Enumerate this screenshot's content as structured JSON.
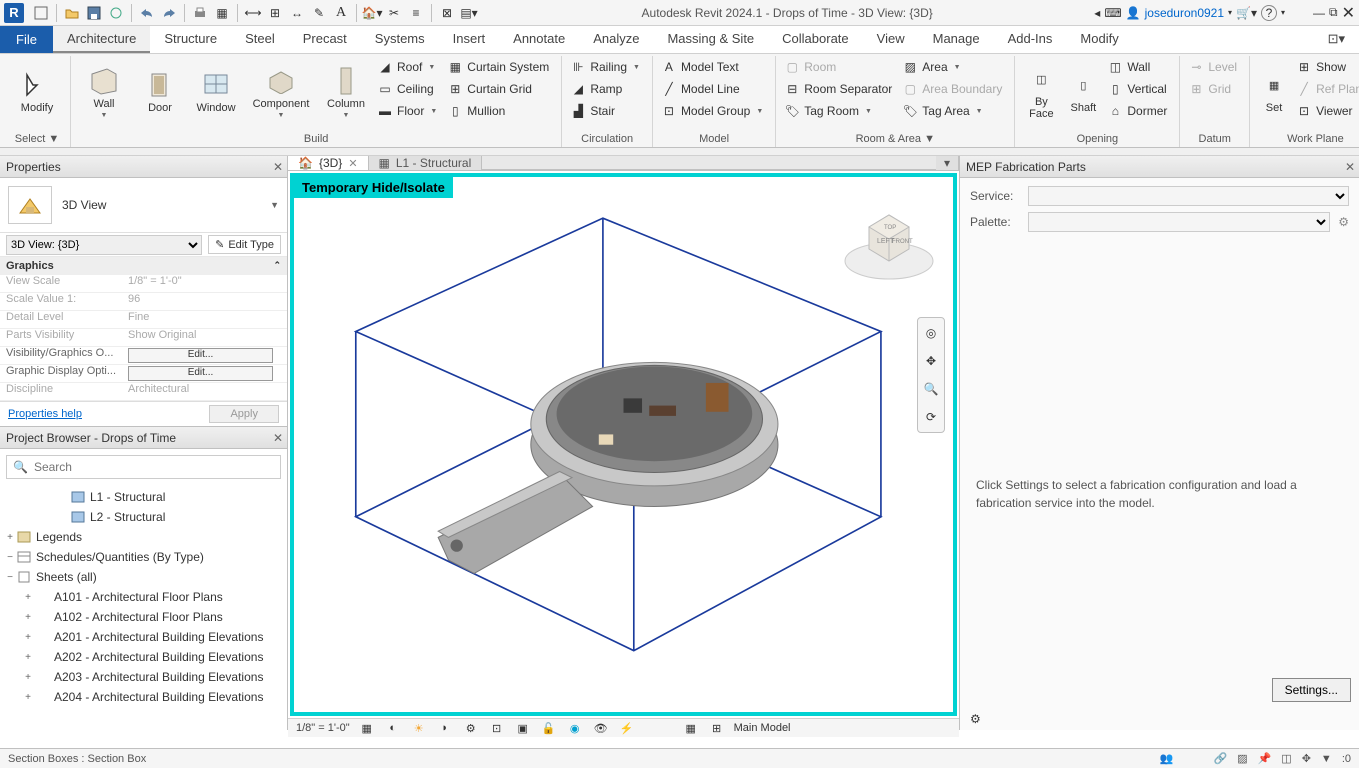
{
  "app": {
    "logo": "R",
    "title": "Autodesk Revit 2024.1 - Drops of Time - 3D View: {3D}",
    "user": "joseduron0921"
  },
  "tabs": {
    "file": "File",
    "items": [
      "Architecture",
      "Structure",
      "Steel",
      "Precast",
      "Systems",
      "Insert",
      "Annotate",
      "Analyze",
      "Massing & Site",
      "Collaborate",
      "View",
      "Manage",
      "Add-Ins",
      "Modify"
    ],
    "active": 0
  },
  "ribbon": {
    "select": {
      "modify": "Modify",
      "label": "Select"
    },
    "build": {
      "label": "Build",
      "wall": "Wall",
      "door": "Door",
      "window": "Window",
      "component": "Component",
      "column": "Column",
      "roof": "Roof",
      "ceiling": "Ceiling",
      "floor": "Floor",
      "curtsys": "Curtain  System",
      "curtgrid": "Curtain  Grid",
      "mullion": "Mullion"
    },
    "circulation": {
      "label": "Circulation",
      "railing": "Railing",
      "ramp": "Ramp",
      "stair": "Stair"
    },
    "model": {
      "label": "Model",
      "text": "Model  Text",
      "line": "Model  Line",
      "group": "Model  Group"
    },
    "room": {
      "label": "Room & Area",
      "room": "Room",
      "sep": "Room  Separator",
      "tag": "Tag  Room",
      "area": "Area",
      "bound": "Area  Boundary",
      "tagarea": "Tag  Area"
    },
    "opening": {
      "label": "Opening",
      "byface": "By\nFace",
      "shaft": "Shaft",
      "wall": "Wall",
      "vertical": "Vertical",
      "dormer": "Dormer"
    },
    "datum": {
      "label": "Datum",
      "level": "Level",
      "grid": "Grid"
    },
    "workplane": {
      "label": "Work Plane",
      "set": "Set",
      "show": "Show",
      "ref": "Ref  Plane",
      "viewer": "Viewer"
    }
  },
  "viewtabs": {
    "active": "{3D}",
    "other": "L1 - Structural"
  },
  "tempbanner": "Temporary Hide/Isolate",
  "props": {
    "title": "Properties",
    "typename": "3D View",
    "selector": "3D View: {3D}",
    "edittype": "Edit Type",
    "cat": "Graphics",
    "rows": [
      {
        "k": "View Scale",
        "v": "1/8\" = 1'-0\"",
        "dis": true
      },
      {
        "k": "Scale Value    1:",
        "v": "96",
        "dis": true
      },
      {
        "k": "Detail Level",
        "v": "Fine",
        "dis": true
      },
      {
        "k": "Parts Visibility",
        "v": "Show Original",
        "dis": true
      },
      {
        "k": "Visibility/Graphics O...",
        "btn": "Edit..."
      },
      {
        "k": "Graphic Display Opti...",
        "btn": "Edit..."
      },
      {
        "k": "Discipline",
        "v": "Architectural",
        "dis": true
      }
    ],
    "help": "Properties help",
    "apply": "Apply"
  },
  "browser": {
    "title": "Project Browser - Drops of Time",
    "search": "Search",
    "items": [
      {
        "ind": 3,
        "exp": "",
        "ico": "view",
        "label": "L1 - Structural"
      },
      {
        "ind": 3,
        "exp": "",
        "ico": "view",
        "label": "L2 - Structural"
      },
      {
        "ind": 0,
        "exp": "+",
        "ico": "legend",
        "label": "Legends"
      },
      {
        "ind": 0,
        "exp": "−",
        "ico": "sched",
        "label": "Schedules/Quantities (By Type)"
      },
      {
        "ind": 0,
        "exp": "−",
        "ico": "sheet",
        "label": "Sheets (all)"
      },
      {
        "ind": 1,
        "exp": "+",
        "ico": "",
        "label": "A101 - Architectural Floor Plans"
      },
      {
        "ind": 1,
        "exp": "+",
        "ico": "",
        "label": "A102 - Architectural Floor Plans"
      },
      {
        "ind": 1,
        "exp": "+",
        "ico": "",
        "label": "A201 - Architectural Building Elevations"
      },
      {
        "ind": 1,
        "exp": "+",
        "ico": "",
        "label": "A202 - Architectural Building Elevations"
      },
      {
        "ind": 1,
        "exp": "+",
        "ico": "",
        "label": "A203 - Architectural Building Elevations"
      },
      {
        "ind": 1,
        "exp": "+",
        "ico": "",
        "label": "A204 - Architectural Building Elevations"
      }
    ]
  },
  "mep": {
    "title": "MEP Fabrication Parts",
    "service": "Service:",
    "palette": "Palette:",
    "msg": "Click Settings to select a fabrication configuration and load a fabrication service into the model.",
    "settings": "Settings..."
  },
  "vcbar": {
    "scale": "1/8\" = 1'-0\"",
    "model": "Main Model"
  },
  "status": {
    "left": "Section Boxes : Section Box",
    "filter": "0"
  }
}
